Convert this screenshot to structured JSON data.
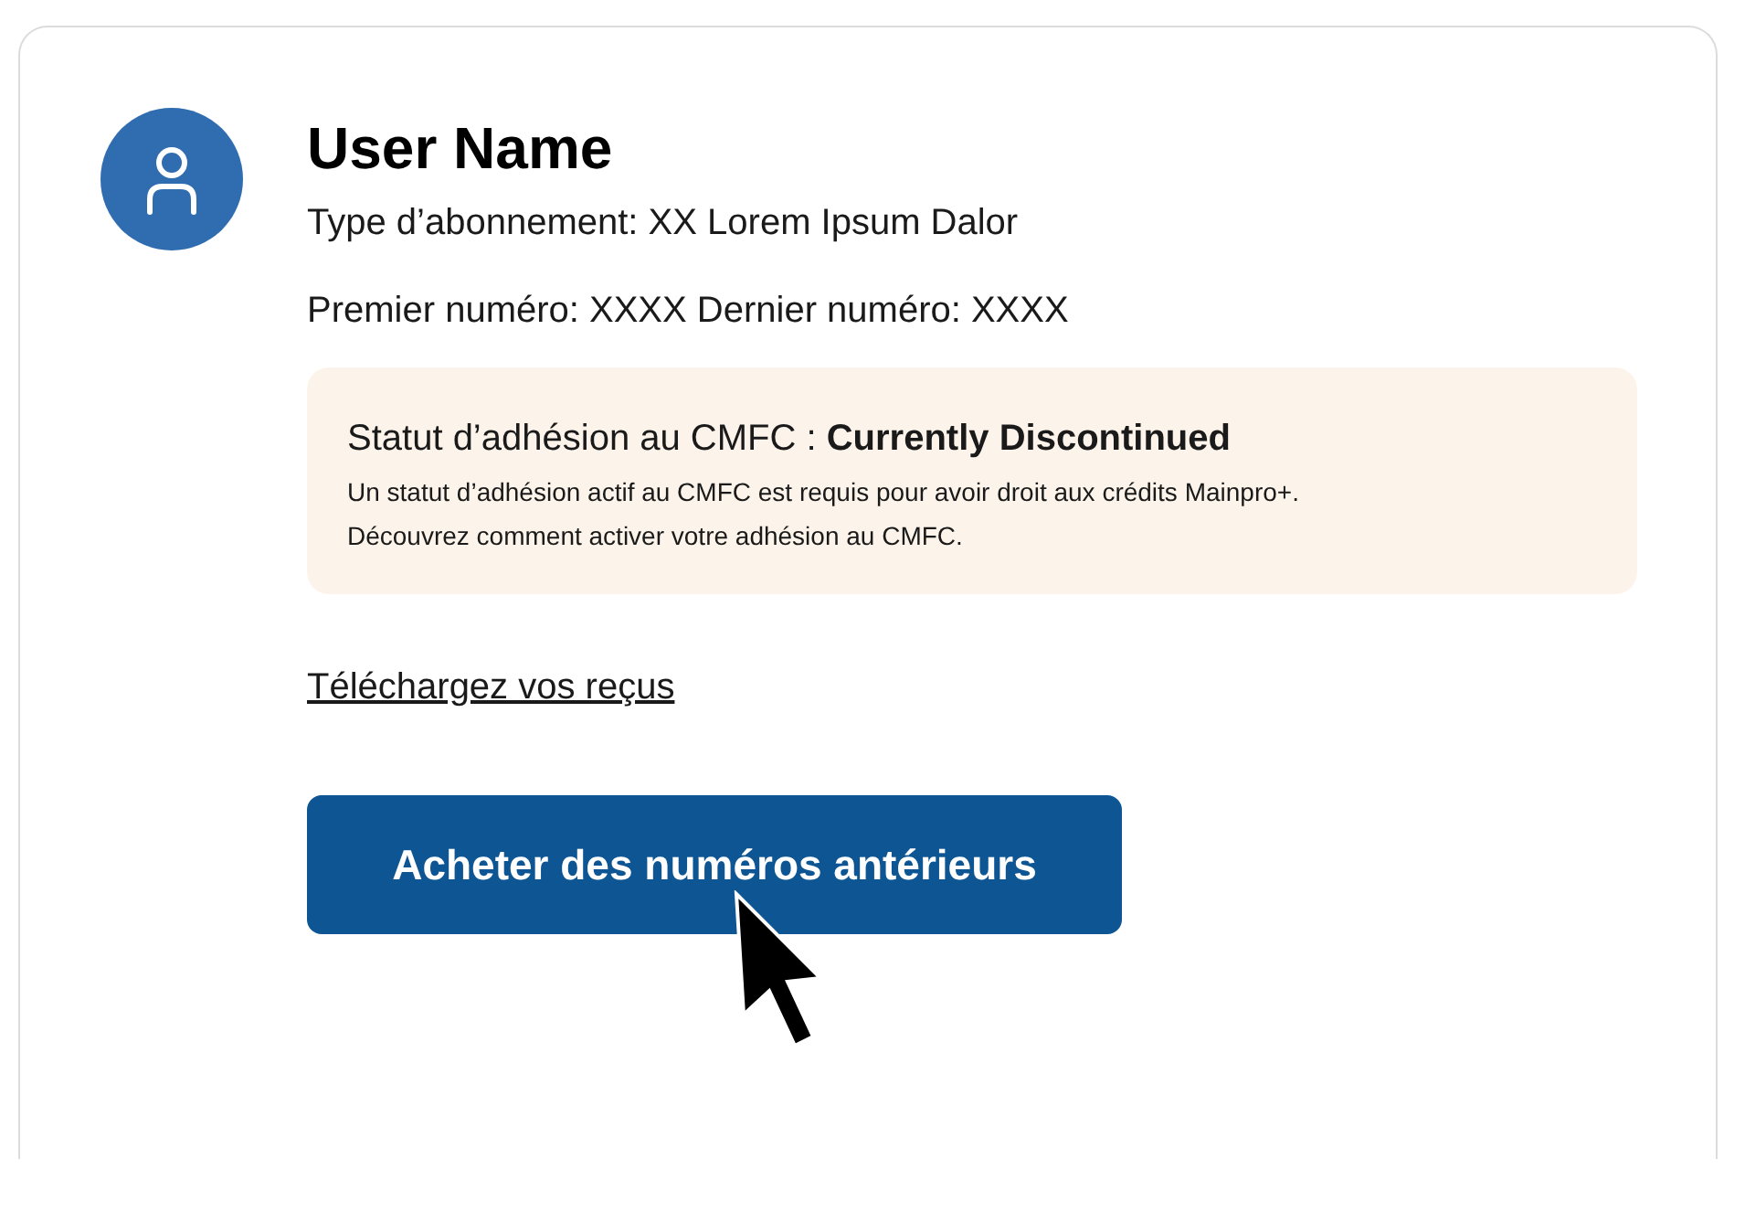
{
  "profile": {
    "name": "User Name",
    "subscription_type": "Type d’abonnement: XX Lorem Ipsum Dalor",
    "issues": "Premier numéro: XXXX Dernier numéro: XXXX"
  },
  "membership_notice": {
    "status": "Statut d’adhésion au CMFC : **Currently Discontinued**",
    "lines": [
      "Un statut d’adhésion actif au CMFC est requis pour avoir droit aux crédits Mainpro+.",
      "Découvrez comment activer votre adhésion au CMFC."
    ]
  },
  "receipts_link": "Téléchargez vos reçus",
  "buy_button": "Acheter des numéros antérieurs"
}
